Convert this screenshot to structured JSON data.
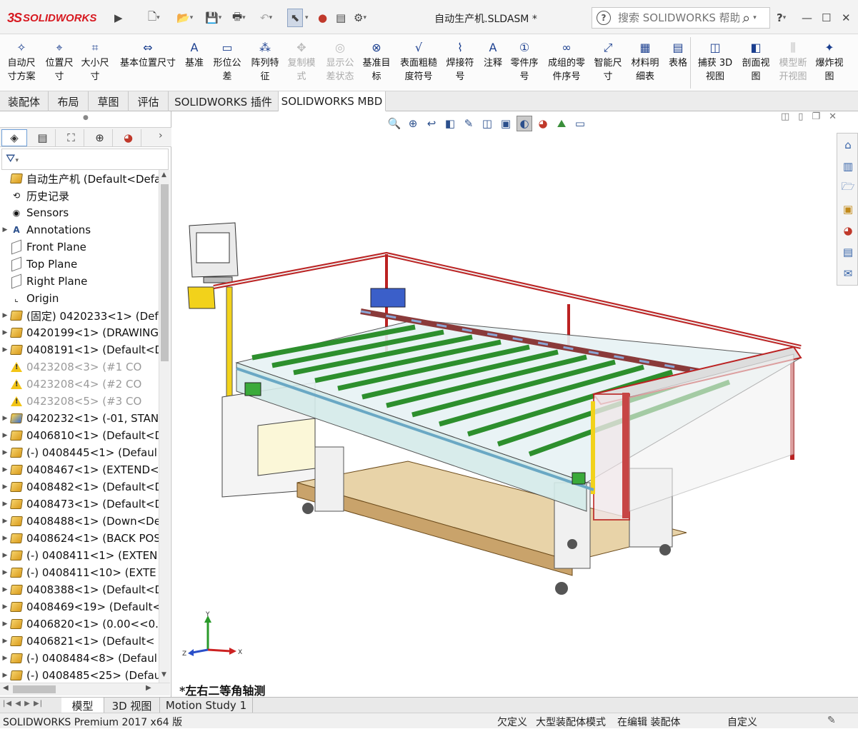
{
  "titlebar": {
    "logo_ds": "3S",
    "logo_text": "SOLIDWORKS",
    "document_title": "自动生产机.SLDASM *",
    "search_placeholder": "搜索 SOLIDWORKS 帮助",
    "help_label": "?",
    "icons": [
      "expand-arrow-icon",
      "new-file-icon",
      "open-file-icon",
      "save-icon",
      "print-icon",
      "undo-icon",
      "select-icon",
      "traffic-light-icon",
      "file-props-icon",
      "options-gear-icon",
      "search-icon",
      "help-icon",
      "minimize-icon",
      "maximize-icon",
      "close-icon"
    ]
  },
  "ribbon": {
    "buttons": [
      {
        "id": "auto-dim",
        "lines": [
          "自动尺",
          "寸方案"
        ],
        "icon": "✧"
      },
      {
        "id": "location-dim",
        "lines": [
          "位置尺",
          "寸"
        ],
        "icon": "⌖"
      },
      {
        "id": "size-dim",
        "lines": [
          "大小尺",
          "寸"
        ],
        "icon": "⌗"
      },
      {
        "id": "basic-location-dim",
        "lines": [
          "基本位置尺寸",
          ""
        ],
        "icon": "⇔"
      },
      {
        "id": "datum",
        "lines": [
          "基准",
          ""
        ],
        "icon": "A"
      },
      {
        "id": "geometric-tolerance",
        "lines": [
          "形位公",
          "差"
        ],
        "icon": "▭"
      },
      {
        "id": "pattern-feature",
        "lines": [
          "阵列特",
          "征"
        ],
        "icon": "⁂"
      },
      {
        "id": "copy-scheme",
        "lines": [
          "复制模",
          "式"
        ],
        "icon": "✥",
        "disabled": true
      },
      {
        "id": "show-tolerance-status",
        "lines": [
          "显示公",
          "差状态"
        ],
        "icon": "◎",
        "disabled": true
      },
      {
        "id": "datum-target",
        "lines": [
          "基准目",
          "标"
        ],
        "icon": "⊗"
      },
      {
        "id": "surface-finish",
        "lines": [
          "表面粗糙",
          "度符号"
        ],
        "icon": "√"
      },
      {
        "id": "weld-symbol",
        "lines": [
          "焊接符",
          "号"
        ],
        "icon": "⌇"
      },
      {
        "id": "note",
        "lines": [
          "注释",
          ""
        ],
        "icon": "A"
      },
      {
        "id": "balloon",
        "lines": [
          "零件序",
          "号"
        ],
        "icon": "①"
      },
      {
        "id": "stacked-balloon",
        "lines": [
          "成组的零",
          "件序号"
        ],
        "icon": "∞"
      },
      {
        "id": "smart-dim",
        "lines": [
          "智能尺",
          "寸"
        ],
        "icon": "⤢"
      },
      {
        "id": "bom",
        "lines": [
          "材料明",
          "细表"
        ],
        "icon": "▦"
      },
      {
        "id": "table",
        "lines": [
          "表格",
          ""
        ],
        "icon": "▤"
      },
      {
        "id": "capture-3d-view",
        "lines": [
          "捕获 3D",
          "视图"
        ],
        "icon": "◫"
      },
      {
        "id": "section-view",
        "lines": [
          "剖面视",
          "图"
        ],
        "icon": "◧"
      },
      {
        "id": "model-break-view",
        "lines": [
          "模型断",
          "开视图"
        ],
        "icon": "⫼",
        "disabled": true
      },
      {
        "id": "exploded-view",
        "lines": [
          "爆炸视",
          "图"
        ],
        "icon": "✦"
      }
    ]
  },
  "command_tabs": [
    "装配体",
    "布局",
    "草图",
    "评估",
    "SOLIDWORKS 插件",
    "SOLIDWORKS MBD"
  ],
  "active_command_tab": "SOLIDWORKS MBD",
  "panel_tabs": [
    "feature-manager-icon",
    "property-manager-icon",
    "configuration-manager-icon",
    "dimxpert-icon",
    "display-manager-icon"
  ],
  "tree": {
    "items": [
      {
        "label": "自动生产机  (Default<Defau",
        "icon": "assembly",
        "arrow": ""
      },
      {
        "label": "历史记录",
        "icon": "history",
        "arrow": ""
      },
      {
        "label": "Sensors",
        "icon": "sensor",
        "arrow": ""
      },
      {
        "label": "Annotations",
        "icon": "annotation",
        "arrow": "▶"
      },
      {
        "label": "Front Plane",
        "icon": "plane",
        "arrow": ""
      },
      {
        "label": "Top Plane",
        "icon": "plane",
        "arrow": ""
      },
      {
        "label": "Right Plane",
        "icon": "plane",
        "arrow": ""
      },
      {
        "label": "Origin",
        "icon": "origin",
        "arrow": ""
      },
      {
        "label": "(固定) 0420233<1> (Def",
        "icon": "asm",
        "arrow": "▶"
      },
      {
        "label": "0420199<1> (DRAWING",
        "icon": "asm",
        "arrow": "▶"
      },
      {
        "label": "0408191<1> (Default<D",
        "icon": "asm",
        "arrow": "▶"
      },
      {
        "label": "0423208<3> (#1 CO",
        "icon": "warn",
        "arrow": "",
        "dim": true
      },
      {
        "label": "0423208<4> (#2 CO",
        "icon": "warn",
        "arrow": "",
        "dim": true
      },
      {
        "label": "0423208<5> (#3 CO",
        "icon": "warn",
        "arrow": "",
        "dim": true
      },
      {
        "label": "0420232<1> (-01, STAN",
        "icon": "asmyb",
        "arrow": "▶"
      },
      {
        "label": "0406810<1> (Default<D",
        "icon": "asm",
        "arrow": "▶"
      },
      {
        "label": "(-) 0408445<1> (Defaul",
        "icon": "asm",
        "arrow": "▶"
      },
      {
        "label": "0408467<1> (EXTEND<",
        "icon": "asm",
        "arrow": "▶"
      },
      {
        "label": "0408482<1> (Default<D",
        "icon": "asm",
        "arrow": "▶"
      },
      {
        "label": "0408473<1> (Default<D",
        "icon": "asm",
        "arrow": "▶"
      },
      {
        "label": "0408488<1> (Down<De",
        "icon": "asm",
        "arrow": "▶"
      },
      {
        "label": "0408624<1> (BACK POS",
        "icon": "asm",
        "arrow": "▶"
      },
      {
        "label": "(-) 0408411<1> (EXTEN",
        "icon": "asm",
        "arrow": "▶"
      },
      {
        "label": "(-) 0408411<10> (EXTE",
        "icon": "asm",
        "arrow": "▶"
      },
      {
        "label": "0408388<1> (Default<D",
        "icon": "asm",
        "arrow": "▶"
      },
      {
        "label": "0408469<19> (Default<",
        "icon": "asm",
        "arrow": "▶"
      },
      {
        "label": "0406820<1> (0.00<<0.",
        "icon": "asm",
        "arrow": "▶"
      },
      {
        "label": "0406821<1> (Default<",
        "icon": "asm",
        "arrow": "▶"
      },
      {
        "label": "(-) 0408484<8> (Defaul",
        "icon": "asm",
        "arrow": "▶"
      },
      {
        "label": "(-) 0408485<25> (Defau",
        "icon": "asm",
        "arrow": "▶"
      }
    ]
  },
  "viewport": {
    "view_name": "*左右二等角轴测",
    "toolbar_icons": [
      "zoom-to-fit-icon",
      "zoom-to-area-icon",
      "previous-view-icon",
      "section-view-icon",
      "dynamic-annotation-icon",
      "view-orientation-icon",
      "display-style-icon",
      "hide-show-icon",
      "edit-appearance-icon",
      "apply-scene-icon",
      "view-settings-icon"
    ],
    "taskpane_icons": [
      "home-icon",
      "design-library-icon",
      "file-explorer-icon",
      "view-palette-icon",
      "appearances-icon",
      "custom-properties-icon",
      "forum-icon"
    ],
    "triad": {
      "x": "X",
      "y": "Y",
      "z": "Z"
    }
  },
  "bottom_tabs": [
    "模型",
    "3D 视图",
    "Motion Study 1"
  ],
  "active_bottom_tab": "模型",
  "statusbar": {
    "product": "SOLIDWORKS Premium 2017 x64 版",
    "under_defined": "欠定义",
    "large_assembly": "大型装配体模式",
    "editing": "在编辑 装配体",
    "custom": "自定义"
  }
}
